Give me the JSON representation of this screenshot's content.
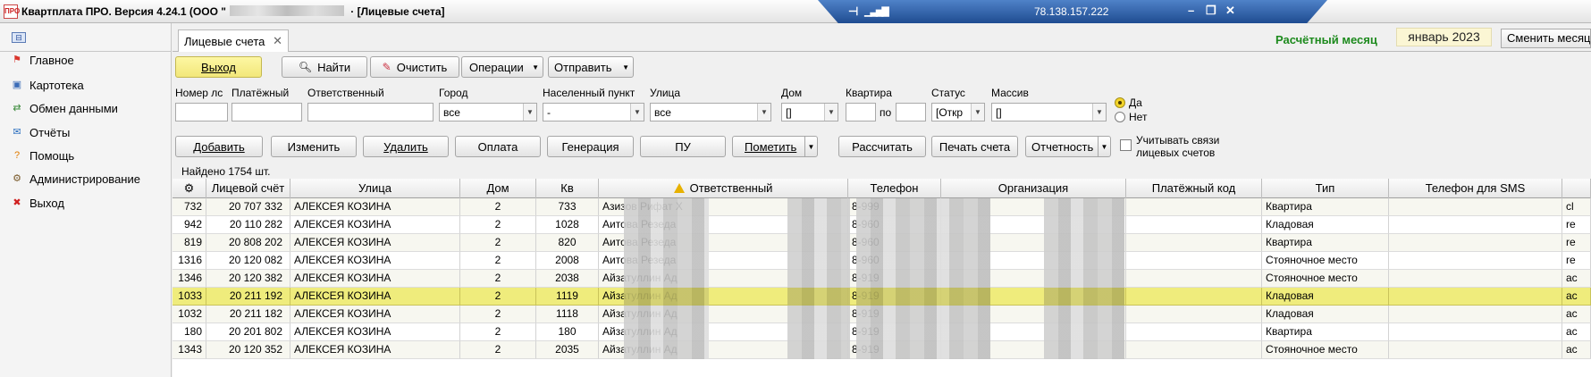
{
  "window": {
    "app_icon": "ПРО",
    "title_prefix": "Квартплата ПРО.  Версия 4.24.1 (ООО \"",
    "title_suffix": " · [Лицевые счета]"
  },
  "remote_bar": {
    "ip": "78.138.157.222",
    "pin_icon": "pin-icon",
    "signal_icon": "signal-icon"
  },
  "sidebar": {
    "items": [
      {
        "label": "Главное",
        "icon": "flag-icon",
        "color": "#d9342b",
        "glyph": "⚑"
      },
      {
        "label": "Картотека",
        "icon": "cards-icon",
        "color": "#3b6cb7",
        "glyph": "▣"
      },
      {
        "label": "Обмен данными",
        "icon": "exchange-icon",
        "color": "#3a8a3a",
        "glyph": "⇄"
      },
      {
        "label": "Отчёты",
        "icon": "reports-icon",
        "color": "#2b6fbf",
        "glyph": "✉"
      },
      {
        "label": "Помощь",
        "icon": "help-icon",
        "color": "#e07b00",
        "glyph": "?"
      },
      {
        "label": "Администрирование",
        "icon": "admin-icon",
        "color": "#7a5a2a",
        "glyph": "⚙"
      },
      {
        "label": "Выход",
        "icon": "exit-icon",
        "color": "#d02020",
        "glyph": "✖"
      }
    ]
  },
  "tabs": [
    {
      "label": "Лицевые счета"
    }
  ],
  "period": {
    "label": "Расчётный месяц",
    "value": "январь 2023",
    "change_button": "Сменить месяц"
  },
  "toolbar": {
    "exit": "Выход",
    "find": "Найти",
    "clear": "Очистить",
    "operations": "Операции",
    "send": "Отправить"
  },
  "filters": {
    "account_no": {
      "label": "Номер лс",
      "value": ""
    },
    "payment_no": {
      "label": "Платёжный",
      "value": ""
    },
    "responsible": {
      "label": "Ответственный",
      "value": ""
    },
    "city": {
      "label": "Город",
      "value": "все"
    },
    "locality": {
      "label": "Населенный пункт",
      "value": "-"
    },
    "street": {
      "label": "Улица",
      "value": "все"
    },
    "house": {
      "label": "Дом",
      "value": "[]"
    },
    "apartment": {
      "label": "Квартира",
      "from": "",
      "to_label": "по",
      "to": ""
    },
    "status": {
      "label": "Статус",
      "value": "[Откр"
    },
    "array": {
      "label": "Массив",
      "value": "[]"
    },
    "radio_yes": "Да",
    "radio_no": "Нет"
  },
  "actions": {
    "add": "Добавить",
    "edit": "Изменить",
    "delete": "Удалить",
    "payment": "Оплата",
    "generation": "Генерация",
    "pu": "ПУ",
    "mark": "Пометить",
    "calculate": "Рассчитать",
    "print": "Печать счета",
    "reporting": "Отчетность",
    "links_checkbox": "Учитывать связи лицевых счетов"
  },
  "found_text": "Найдено 1754 шт.",
  "grid": {
    "columns": [
      "",
      "Лицевой счёт",
      "Улица",
      "Дом",
      "Кв",
      "Ответственный",
      "Телефон",
      "Организация",
      "Платёжный код",
      "Тип",
      "Телефон для SMS",
      ""
    ],
    "rows": [
      {
        "id": "732",
        "account": "20 707 332",
        "street": "АЛЕКСЕЯ КОЗИНА",
        "house": "2",
        "apt": "733",
        "resp": "Азизов Рифат Х",
        "phone": "8-999",
        "type": "Квартира",
        "sms": "",
        "extra": "cl"
      },
      {
        "id": "942",
        "account": "20 110 282",
        "street": "АЛЕКСЕЯ КОЗИНА",
        "house": "2",
        "apt": "1028",
        "resp": "Аитова Резеда",
        "phone": "8-960",
        "type": "Кладовая",
        "sms": "",
        "extra": "re"
      },
      {
        "id": "819",
        "account": "20 808 202",
        "street": "АЛЕКСЕЯ КОЗИНА",
        "house": "2",
        "apt": "820",
        "resp": "Аитова Резеда",
        "phone": "8-960",
        "type": "Квартира",
        "sms": "",
        "extra": "re"
      },
      {
        "id": "1316",
        "account": "20 120 082",
        "street": "АЛЕКСЕЯ КОЗИНА",
        "house": "2",
        "apt": "2008",
        "resp": "Аитова Резеда",
        "phone": "8-960",
        "type": "Стояночное место",
        "sms": "",
        "extra": "re"
      },
      {
        "id": "1346",
        "account": "20 120 382",
        "street": "АЛЕКСЕЯ КОЗИНА",
        "house": "2",
        "apt": "2038",
        "resp": "Айзатуллин Ад",
        "phone": "8-919",
        "type": "Стояночное место",
        "sms": "",
        "extra": "ac"
      },
      {
        "id": "1033",
        "account": "20 211 192",
        "street": "АЛЕКСЕЯ КОЗИНА",
        "house": "2",
        "apt": "1119",
        "resp": "Айзатуллин Ад",
        "phone": "8-919",
        "type": "Кладовая",
        "sms": "",
        "extra": "ac",
        "selected": true
      },
      {
        "id": "1032",
        "account": "20 211 182",
        "street": "АЛЕКСЕЯ КОЗИНА",
        "house": "2",
        "apt": "1118",
        "resp": "Айзатуллин Ад",
        "phone": "8-919",
        "type": "Кладовая",
        "sms": "",
        "extra": "ac"
      },
      {
        "id": "180",
        "account": "20 201 802",
        "street": "АЛЕКСЕЯ КОЗИНА",
        "house": "2",
        "apt": "180",
        "resp": "Айзатуллин Ад",
        "phone": "8-919",
        "type": "Квартира",
        "sms": "",
        "extra": "ac"
      },
      {
        "id": "1343",
        "account": "20 120 352",
        "street": "АЛЕКСЕЯ КОЗИНА",
        "house": "2",
        "apt": "2035",
        "resp": "Айзатуллин Ад",
        "phone": "8-919",
        "type": "Стояночное место",
        "sms": "",
        "extra": "ac"
      }
    ]
  }
}
